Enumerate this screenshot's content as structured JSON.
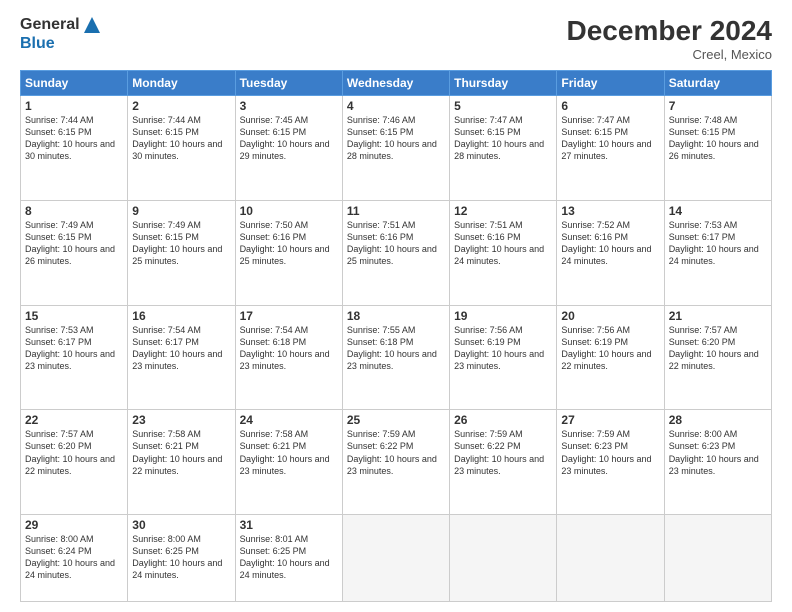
{
  "logo": {
    "general": "General",
    "blue": "Blue"
  },
  "title": "December 2024",
  "location": "Creel, Mexico",
  "days_header": [
    "Sunday",
    "Monday",
    "Tuesday",
    "Wednesday",
    "Thursday",
    "Friday",
    "Saturday"
  ],
  "weeks": [
    [
      {
        "day": "1",
        "sunrise": "7:44 AM",
        "sunset": "6:15 PM",
        "daylight": "10 hours and 30 minutes."
      },
      {
        "day": "2",
        "sunrise": "7:44 AM",
        "sunset": "6:15 PM",
        "daylight": "10 hours and 30 minutes."
      },
      {
        "day": "3",
        "sunrise": "7:45 AM",
        "sunset": "6:15 PM",
        "daylight": "10 hours and 29 minutes."
      },
      {
        "day": "4",
        "sunrise": "7:46 AM",
        "sunset": "6:15 PM",
        "daylight": "10 hours and 28 minutes."
      },
      {
        "day": "5",
        "sunrise": "7:47 AM",
        "sunset": "6:15 PM",
        "daylight": "10 hours and 28 minutes."
      },
      {
        "day": "6",
        "sunrise": "7:47 AM",
        "sunset": "6:15 PM",
        "daylight": "10 hours and 27 minutes."
      },
      {
        "day": "7",
        "sunrise": "7:48 AM",
        "sunset": "6:15 PM",
        "daylight": "10 hours and 26 minutes."
      }
    ],
    [
      {
        "day": "8",
        "sunrise": "7:49 AM",
        "sunset": "6:15 PM",
        "daylight": "10 hours and 26 minutes."
      },
      {
        "day": "9",
        "sunrise": "7:49 AM",
        "sunset": "6:15 PM",
        "daylight": "10 hours and 25 minutes."
      },
      {
        "day": "10",
        "sunrise": "7:50 AM",
        "sunset": "6:16 PM",
        "daylight": "10 hours and 25 minutes."
      },
      {
        "day": "11",
        "sunrise": "7:51 AM",
        "sunset": "6:16 PM",
        "daylight": "10 hours and 25 minutes."
      },
      {
        "day": "12",
        "sunrise": "7:51 AM",
        "sunset": "6:16 PM",
        "daylight": "10 hours and 24 minutes."
      },
      {
        "day": "13",
        "sunrise": "7:52 AM",
        "sunset": "6:16 PM",
        "daylight": "10 hours and 24 minutes."
      },
      {
        "day": "14",
        "sunrise": "7:53 AM",
        "sunset": "6:17 PM",
        "daylight": "10 hours and 24 minutes."
      }
    ],
    [
      {
        "day": "15",
        "sunrise": "7:53 AM",
        "sunset": "6:17 PM",
        "daylight": "10 hours and 23 minutes."
      },
      {
        "day": "16",
        "sunrise": "7:54 AM",
        "sunset": "6:17 PM",
        "daylight": "10 hours and 23 minutes."
      },
      {
        "day": "17",
        "sunrise": "7:54 AM",
        "sunset": "6:18 PM",
        "daylight": "10 hours and 23 minutes."
      },
      {
        "day": "18",
        "sunrise": "7:55 AM",
        "sunset": "6:18 PM",
        "daylight": "10 hours and 23 minutes."
      },
      {
        "day": "19",
        "sunrise": "7:56 AM",
        "sunset": "6:19 PM",
        "daylight": "10 hours and 23 minutes."
      },
      {
        "day": "20",
        "sunrise": "7:56 AM",
        "sunset": "6:19 PM",
        "daylight": "10 hours and 22 minutes."
      },
      {
        "day": "21",
        "sunrise": "7:57 AM",
        "sunset": "6:20 PM",
        "daylight": "10 hours and 22 minutes."
      }
    ],
    [
      {
        "day": "22",
        "sunrise": "7:57 AM",
        "sunset": "6:20 PM",
        "daylight": "10 hours and 22 minutes."
      },
      {
        "day": "23",
        "sunrise": "7:58 AM",
        "sunset": "6:21 PM",
        "daylight": "10 hours and 22 minutes."
      },
      {
        "day": "24",
        "sunrise": "7:58 AM",
        "sunset": "6:21 PM",
        "daylight": "10 hours and 23 minutes."
      },
      {
        "day": "25",
        "sunrise": "7:59 AM",
        "sunset": "6:22 PM",
        "daylight": "10 hours and 23 minutes."
      },
      {
        "day": "26",
        "sunrise": "7:59 AM",
        "sunset": "6:22 PM",
        "daylight": "10 hours and 23 minutes."
      },
      {
        "day": "27",
        "sunrise": "7:59 AM",
        "sunset": "6:23 PM",
        "daylight": "10 hours and 23 minutes."
      },
      {
        "day": "28",
        "sunrise": "8:00 AM",
        "sunset": "6:23 PM",
        "daylight": "10 hours and 23 minutes."
      }
    ],
    [
      {
        "day": "29",
        "sunrise": "8:00 AM",
        "sunset": "6:24 PM",
        "daylight": "10 hours and 24 minutes."
      },
      {
        "day": "30",
        "sunrise": "8:00 AM",
        "sunset": "6:25 PM",
        "daylight": "10 hours and 24 minutes."
      },
      {
        "day": "31",
        "sunrise": "8:01 AM",
        "sunset": "6:25 PM",
        "daylight": "10 hours and 24 minutes."
      },
      null,
      null,
      null,
      null
    ]
  ]
}
